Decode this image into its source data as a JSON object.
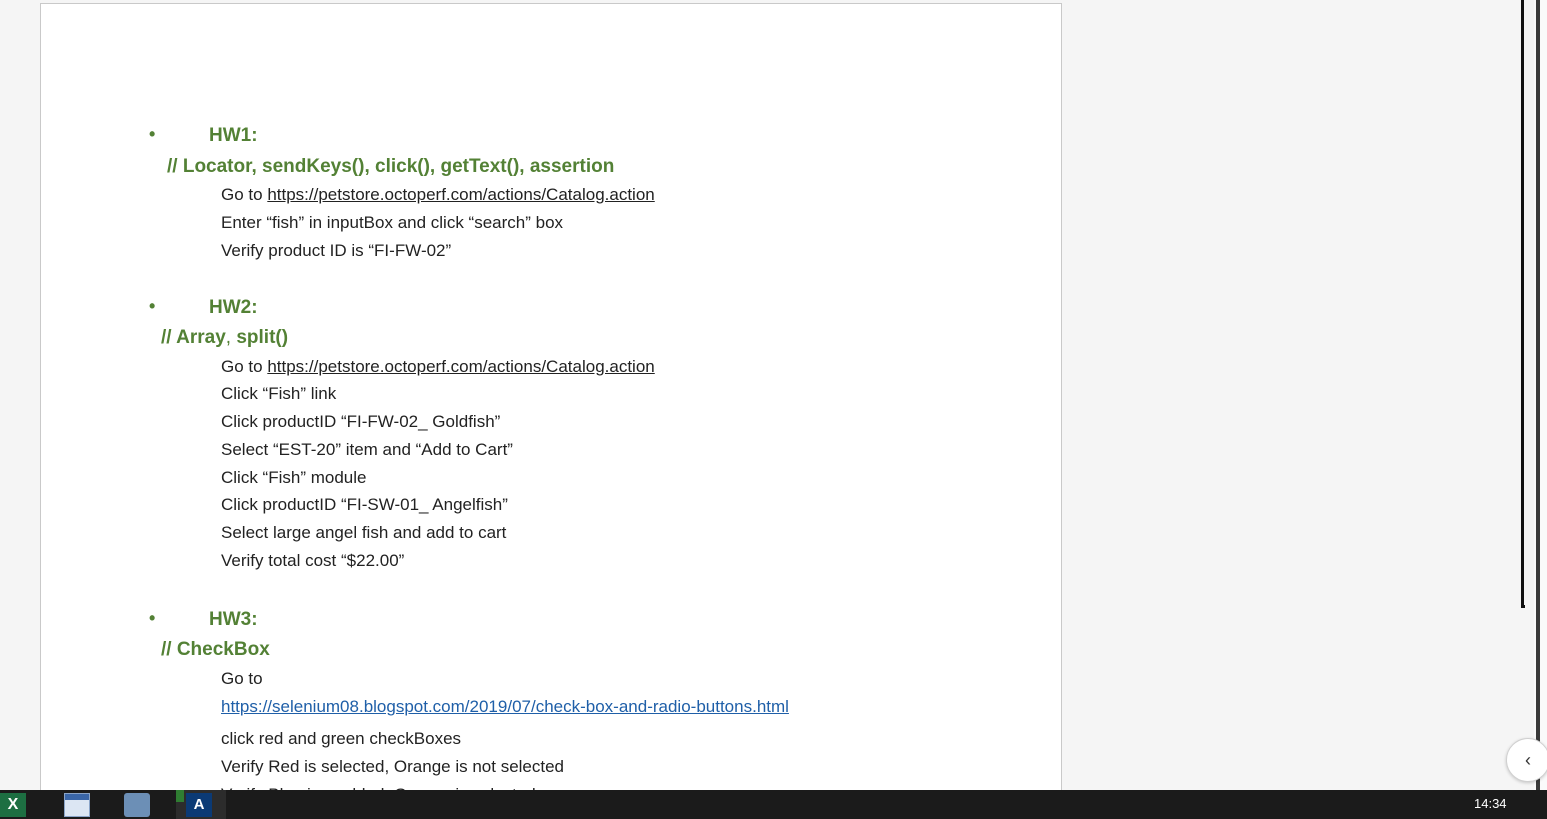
{
  "document": {
    "hw1": {
      "bullet": "•",
      "title": "HW1:",
      "subtitle": "// Locator, sendKeys(), click(), getText(), assertion",
      "steps": [
        {
          "prefix": "Go to ",
          "link": "https://petstore.octoperf.com/actions/Catalog.action"
        },
        {
          "text": "Enter “fish” in inputBox and click “search” box"
        },
        {
          "text": "Verify product ID is “FI-FW-02”"
        }
      ]
    },
    "hw2": {
      "bullet": "•",
      "title": "HW2:",
      "subtitle_a": "// Array",
      "subtitle_comma": ",",
      "subtitle_b": " split()",
      "steps": [
        {
          "prefix": "Go to ",
          "link": "https://petstore.octoperf.com/actions/Catalog.action"
        },
        {
          "text": "Click “Fish” link"
        },
        {
          "text": "Click productID “FI-FW-02_ Goldfish”"
        },
        {
          "text": "Select “EST-20” item and “Add to Cart”"
        },
        {
          "text": "Click “Fish” module"
        },
        {
          "text": "Click productID “FI-SW-01_ Angelfish”"
        },
        {
          "text": "Select large angel fish and add to cart"
        },
        {
          "text": "Verify total cost “$22.00”"
        }
      ]
    },
    "hw3": {
      "bullet": "•",
      "title": "HW3:",
      "subtitle": "// CheckBox",
      "steps": [
        {
          "text": "Go to"
        },
        {
          "link": "https://selenium08.blogspot.com/2019/07/check-box-and-radio-buttons.html"
        },
        {
          "text": "click red and green checkBoxes"
        },
        {
          "text": "Verify Red is selected, Orange is not selected"
        },
        {
          "text": "Verify Blue is enabled, Orange is selected"
        }
      ]
    }
  },
  "colors": {
    "heading_green": "#538135",
    "link_blue": "#1f5fa8"
  },
  "taskbar": {
    "clock": "14:34",
    "icons": [
      "excel-icon",
      "window-icon",
      "remote-desktop-icon",
      "azure-icon"
    ]
  },
  "collapse_icon": "‹"
}
